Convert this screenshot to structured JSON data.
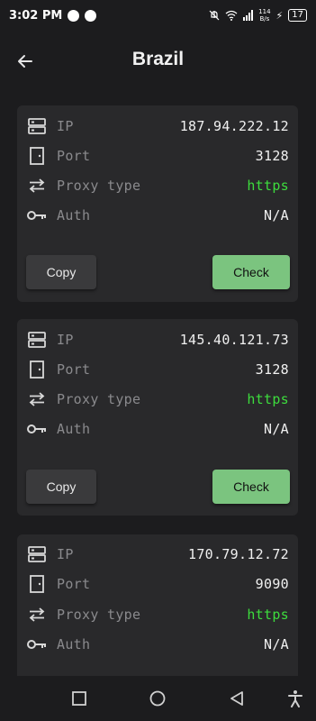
{
  "status": {
    "time": "3:02 PM",
    "netspeed_top": "114",
    "netspeed_bottom": "B/s",
    "battery": "17"
  },
  "header": {
    "title": "Brazil"
  },
  "labels": {
    "ip": "IP",
    "port": "Port",
    "proxy_type": "Proxy type",
    "auth": "Auth",
    "copy": "Copy",
    "check": "Check"
  },
  "proxies": [
    {
      "ip": "187.94.222.12",
      "port": "3128",
      "proxy_type": "https",
      "auth": "N/A"
    },
    {
      "ip": "145.40.121.73",
      "port": "3128",
      "proxy_type": "https",
      "auth": "N/A"
    },
    {
      "ip": "170.79.12.72",
      "port": "9090",
      "proxy_type": "https",
      "auth": "N/A"
    }
  ],
  "colors": {
    "background": "#1c1c1e",
    "card": "#29292b",
    "accent_green": "#7bc47f",
    "proxy_type_green": "#3ddc3d"
  },
  "icons": {
    "ip": "server-icon",
    "port": "door-icon",
    "proxy_type": "swap-arrows-icon",
    "auth": "key-icon",
    "back": "arrow-left-icon"
  },
  "navbar": {
    "items": [
      "recent-apps-icon",
      "home-icon",
      "back-triangle-icon",
      "accessibility-icon"
    ]
  }
}
